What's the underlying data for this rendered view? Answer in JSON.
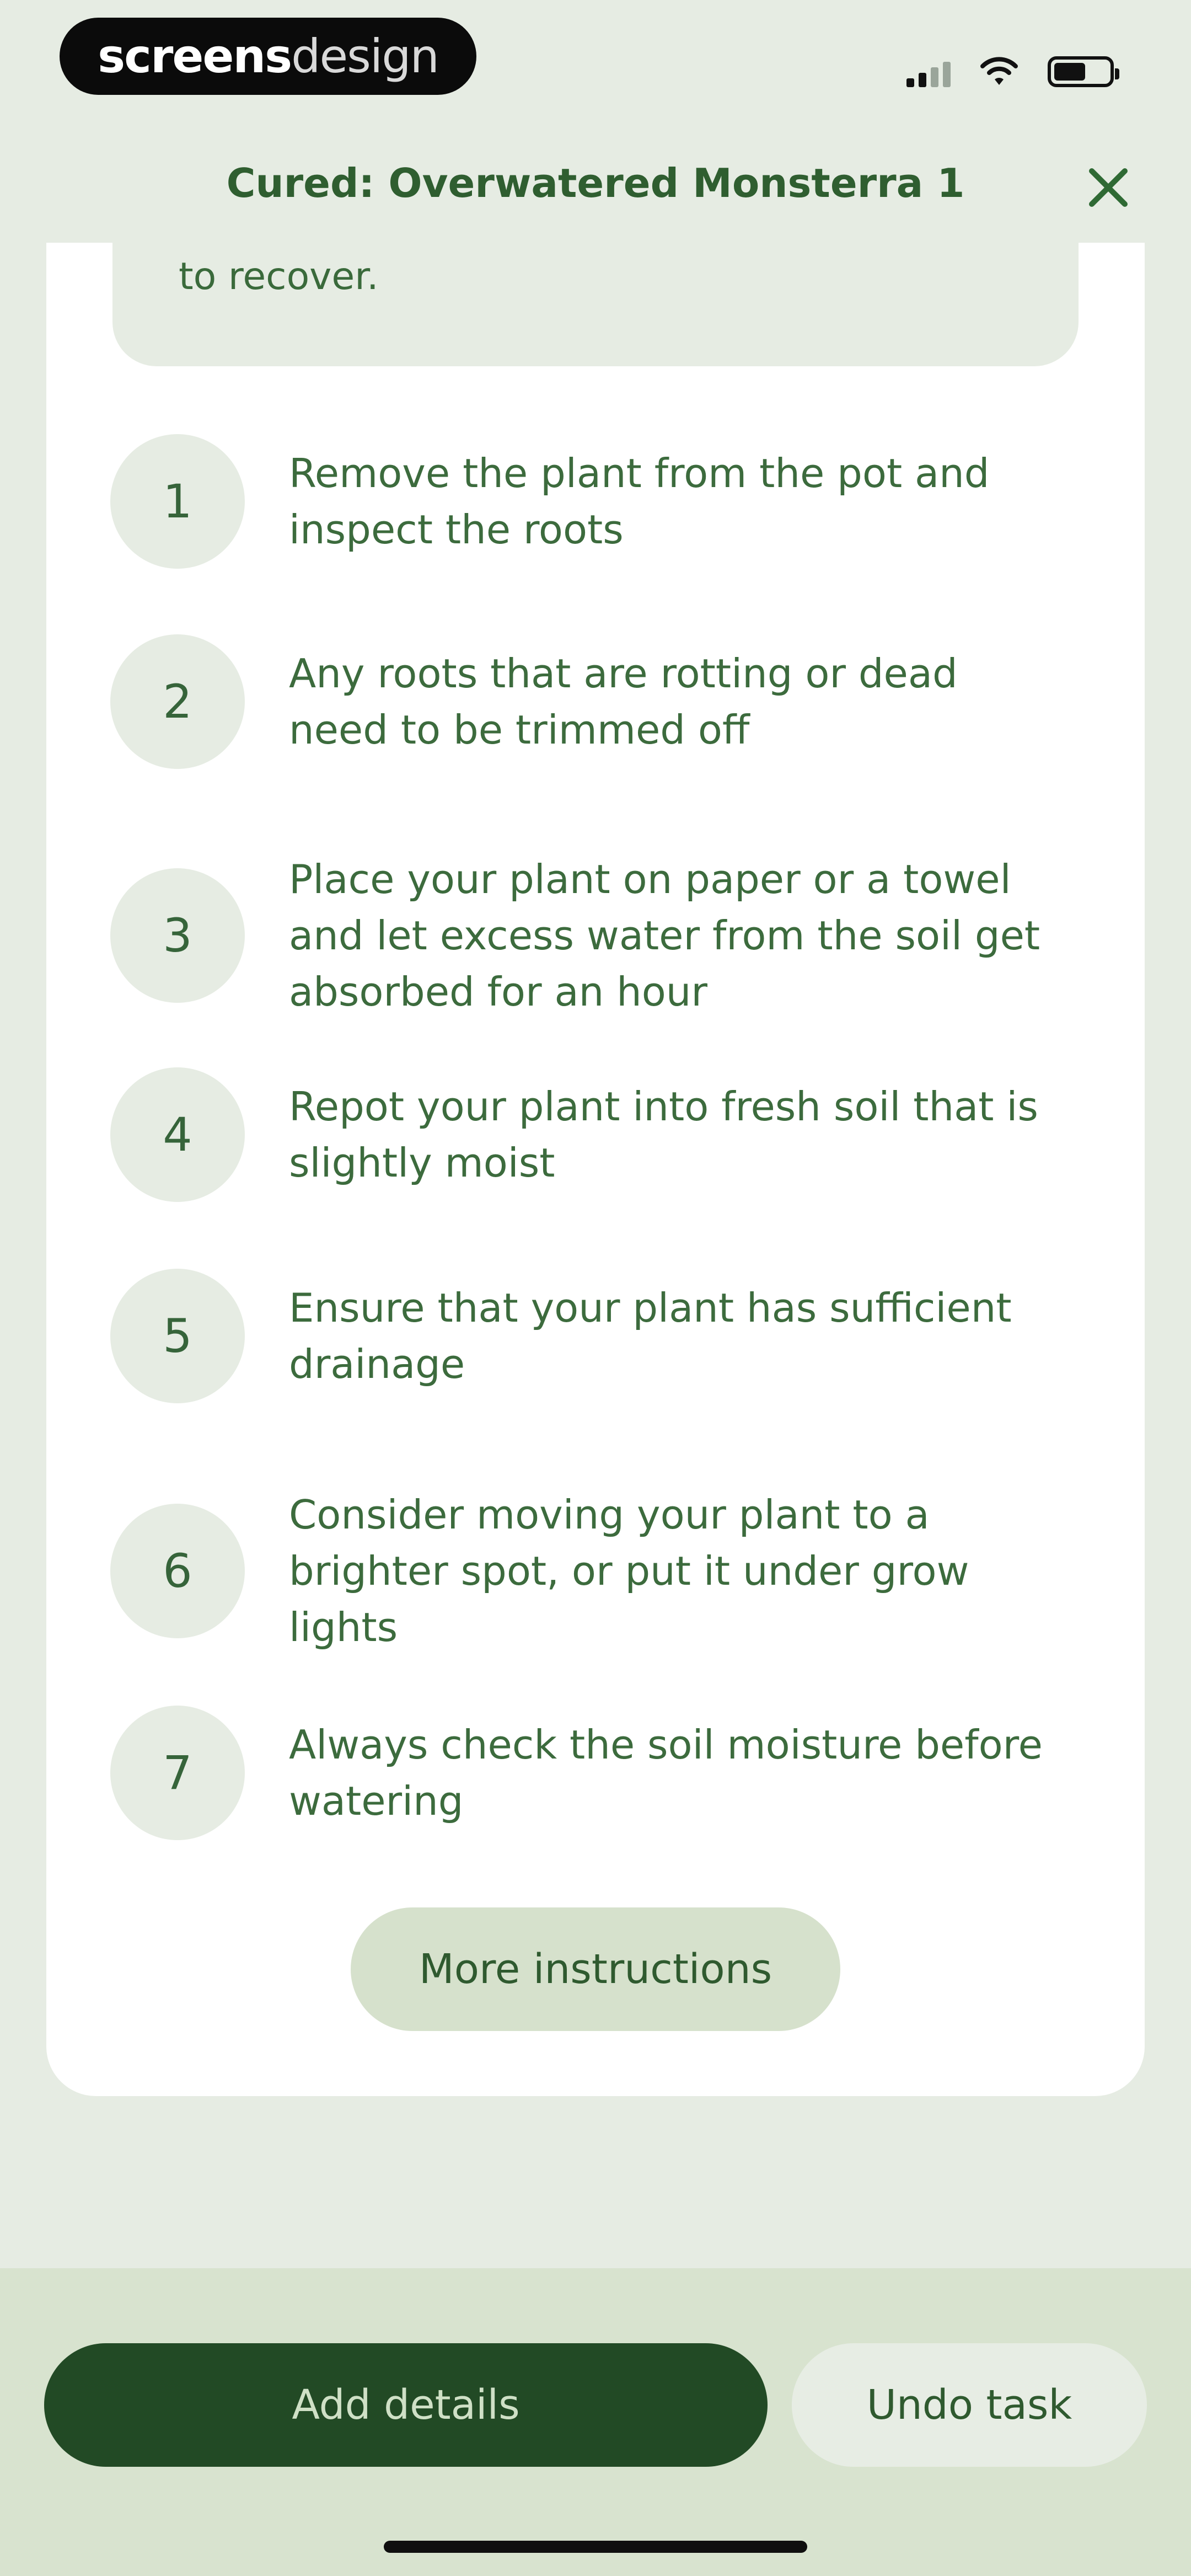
{
  "status_bar": {
    "brand_bold": "screens",
    "brand_light": "design"
  },
  "header": {
    "title": "Cured: Overwatered Monsterra 1",
    "close_icon": "close-icon"
  },
  "note": {
    "text": "to recover."
  },
  "steps": [
    {
      "number": "1",
      "text": "Remove the plant from the pot and inspect the roots"
    },
    {
      "number": "2",
      "text": "Any roots that are rotting or dead need to be trimmed off"
    },
    {
      "number": "3",
      "text": "Place your plant on paper or a towel and let excess water from the soil get absorbed for an hour"
    },
    {
      "number": "4",
      "text": "Repot your plant into fresh soil that is slightly moist"
    },
    {
      "number": "5",
      "text": "Ensure that your plant has sufficient drainage"
    },
    {
      "number": "6",
      "text": "Consider moving your plant to a brighter spot, or put it under grow lights"
    },
    {
      "number": "7",
      "text": "Always check the soil moisture before watering"
    }
  ],
  "actions": {
    "more_instructions": "More instructions",
    "add_details": "Add details",
    "undo_task": "Undo task"
  },
  "colors": {
    "background": "#e6ece3",
    "primary_dark": "#224a25",
    "accent_light": "#d6e1cc",
    "text_green": "#2f5e30"
  }
}
